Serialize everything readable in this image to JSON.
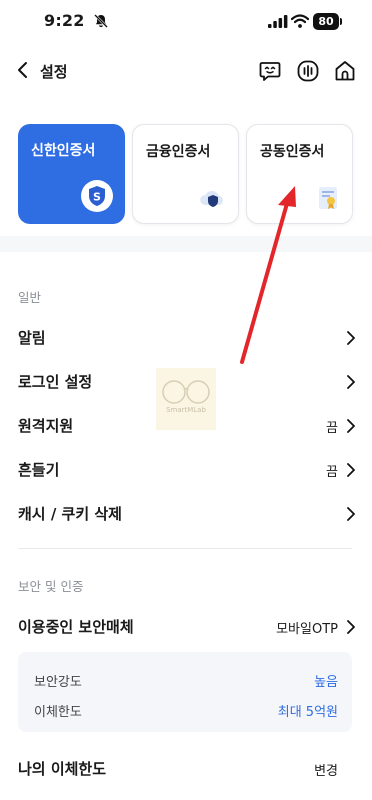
{
  "status_bar": {
    "time": "9:22",
    "battery": "80"
  },
  "header": {
    "title": "설정"
  },
  "cert_cards": [
    {
      "label": "신한인증서"
    },
    {
      "label": "금융인증서"
    },
    {
      "label": "공동인증서"
    }
  ],
  "general": {
    "header": "일반",
    "items": [
      {
        "label": "알림",
        "value": ""
      },
      {
        "label": "로그인 설정",
        "value": ""
      },
      {
        "label": "원격지원",
        "value": "끔"
      },
      {
        "label": "흔들기",
        "value": "끔"
      },
      {
        "label": "캐시 / 쿠키 삭제",
        "value": ""
      }
    ]
  },
  "security": {
    "header": "보안 및 인증",
    "media": {
      "label": "이용중인 보안매체",
      "value": "모바일OTP"
    },
    "details": [
      {
        "label": "보안강도",
        "value": "높음"
      },
      {
        "label": "이체한도",
        "value": "최대 5억원"
      }
    ],
    "cutoff_item": {
      "label": "나의 이체한도",
      "value": "변경"
    }
  },
  "watermark": {
    "text": "SmartMLab"
  },
  "colors": {
    "accent": "#2f6de3",
    "annotation": "#e3262a"
  }
}
